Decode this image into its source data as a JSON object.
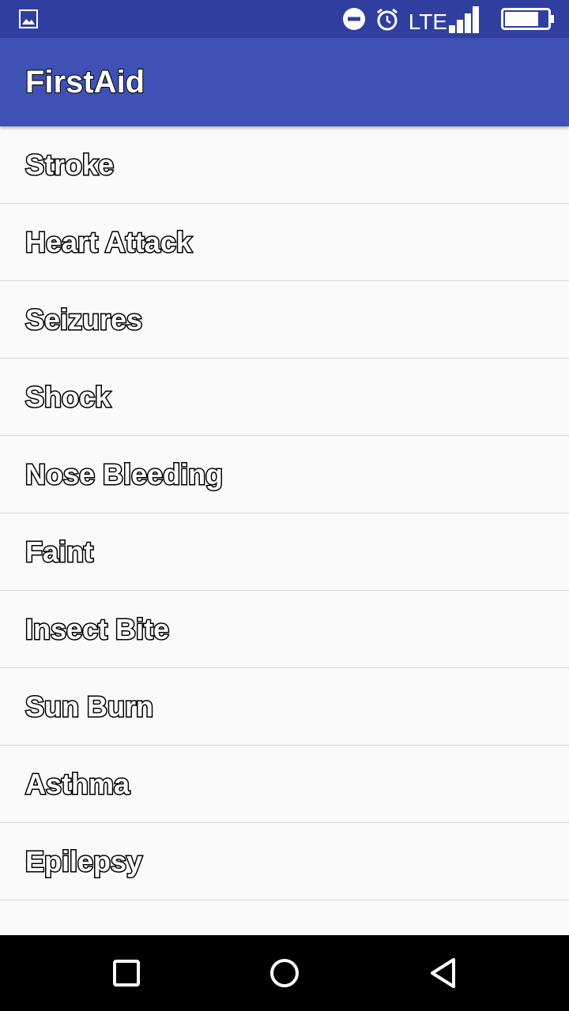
{
  "status_bar": {
    "network_label": "LTE",
    "icons": [
      "gallery-icon",
      "do-not-disturb-icon",
      "alarm-icon",
      "signal-icon",
      "battery-icon"
    ],
    "background_color": "#303f9f"
  },
  "app_bar": {
    "title": "FirstAid",
    "background_color": "#3f51b5"
  },
  "topics": [
    {
      "label": "Stroke"
    },
    {
      "label": "Heart Attack"
    },
    {
      "label": "Seizures"
    },
    {
      "label": "Shock"
    },
    {
      "label": "Nose Bleeding"
    },
    {
      "label": "Faint"
    },
    {
      "label": "Insect Bite"
    },
    {
      "label": "Sun Burn"
    },
    {
      "label": "Asthma"
    },
    {
      "label": "Epilepsy"
    }
  ],
  "nav_bar": {
    "icons": [
      "recent-apps-icon",
      "home-icon",
      "back-icon"
    ]
  }
}
